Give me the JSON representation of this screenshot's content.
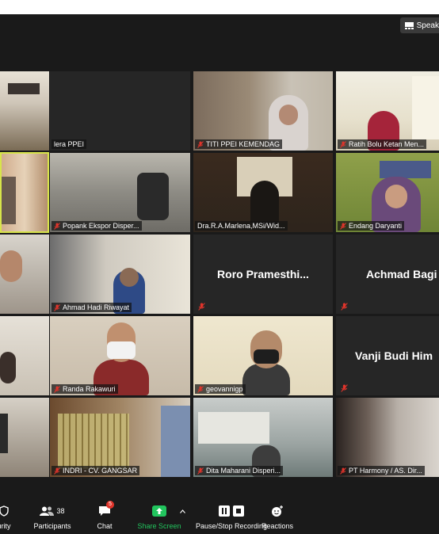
{
  "top_bar": {
    "speaker_view_label": "Speak"
  },
  "tiles": {
    "r1": [
      "",
      "lera PPEI",
      "TITI PPEI KEMENDAG",
      "Ratih Bolu Ketan Men..."
    ],
    "r2": [
      "",
      "Popank Ekspor Disper...",
      "Dra.R.A.Marlena,MSi/Wid...",
      "Endang Daryanti"
    ],
    "r3": [
      "",
      "Ahmad Hadi Riwayat",
      "Roro  Pramesthi...",
      "Achmad Bagi"
    ],
    "r4": [
      "",
      "Randa Rakawuri",
      "geovannigp",
      "Vanji Budi Him"
    ],
    "r5": [
      "",
      "INDRI - CV. GANGSAR",
      "Dita Maharani Disperi...",
      "PT Harmony / AS. Dir..."
    ]
  },
  "toolbar": {
    "security": "urity",
    "participants": "Participants",
    "participants_count": "38",
    "chat": "Chat",
    "chat_badge": "5",
    "share_screen": "Share Screen",
    "recording": "Pause/Stop Recording",
    "reactions": "Reactions"
  },
  "colors": {
    "active_speaker": "#d7e44a",
    "share_green": "#22c55e",
    "mute_red": "#e0342b",
    "badge_red": "#e0342b"
  }
}
